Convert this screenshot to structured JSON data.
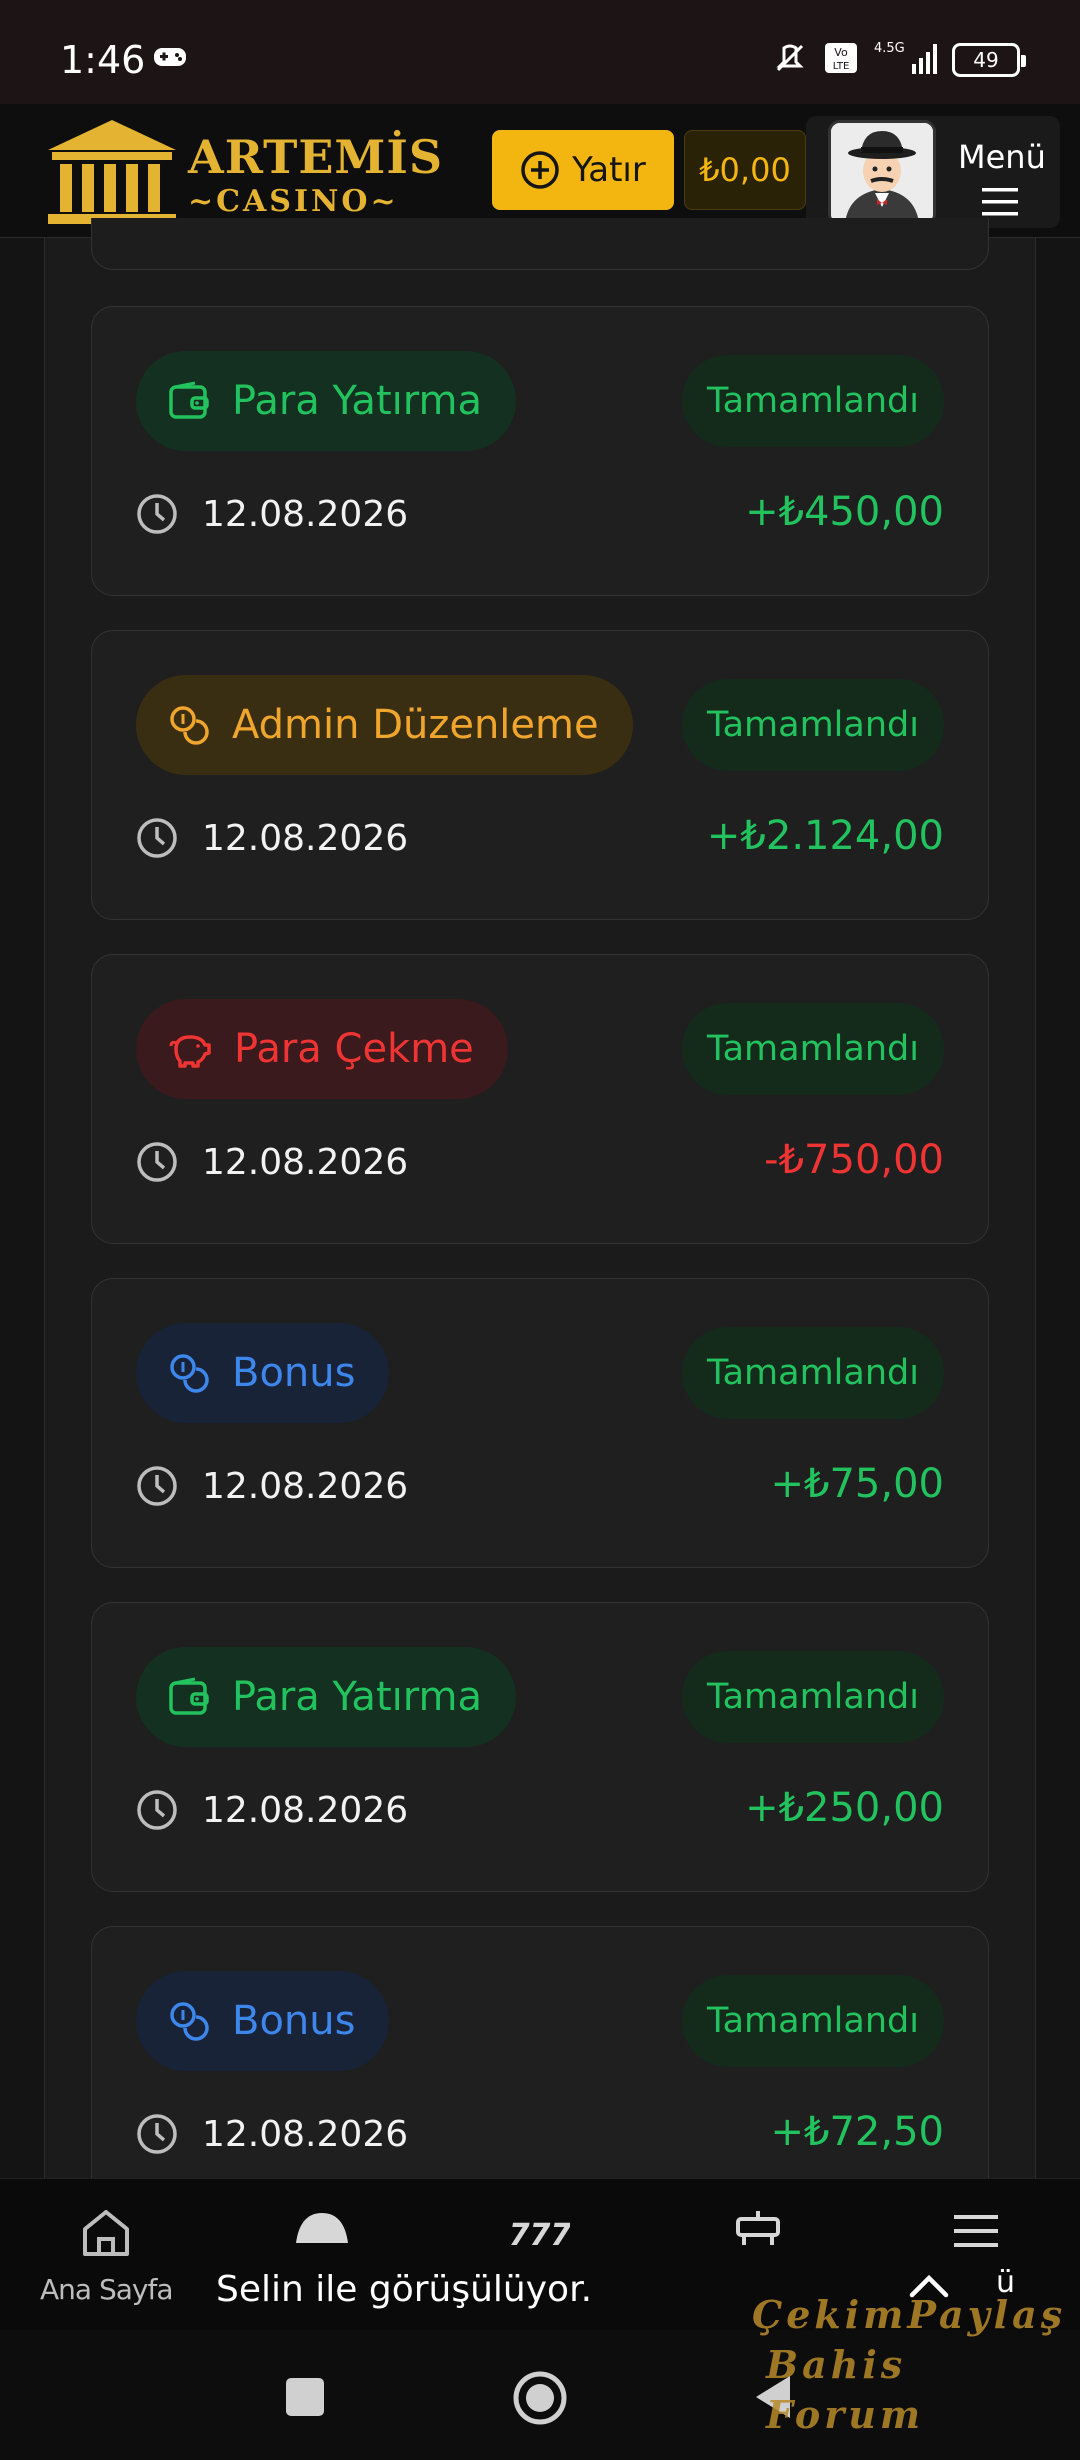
{
  "status_bar": {
    "time": "1:46",
    "battery": "49",
    "network": "4.5G"
  },
  "header": {
    "logo_name": "ARTEMİS",
    "logo_sub": "CASINO",
    "deposit_label": "Yatır",
    "balance": "₺0,00",
    "menu_label": "Menü"
  },
  "transactions": [
    {
      "type": "Para Yatırma",
      "status": "Tamamlandı",
      "date": "12.08.2026",
      "amount": "+₺450,00",
      "kind": "deposit"
    },
    {
      "type": "Admin Düzenleme",
      "status": "Tamamlandı",
      "date": "12.08.2026",
      "amount": "+₺2.124,00",
      "kind": "admin"
    },
    {
      "type": "Para Çekme",
      "status": "Tamamlandı",
      "date": "12.08.2026",
      "amount": "-₺750,00",
      "kind": "withdraw"
    },
    {
      "type": "Bonus",
      "status": "Tamamlandı",
      "date": "12.08.2026",
      "amount": "+₺75,00",
      "kind": "bonus"
    },
    {
      "type": "Para Yatırma",
      "status": "Tamamlandı",
      "date": "12.08.2026",
      "amount": "+₺250,00",
      "kind": "deposit"
    },
    {
      "type": "Bonus",
      "status": "Tamamlandı",
      "date": "12.08.2026",
      "amount": "+₺72,50",
      "kind": "bonus"
    }
  ],
  "bottom_nav": {
    "home_label": "Ana Sayfa",
    "toast": "Selin ile görüşülüyor.",
    "trailing_char": "ü"
  },
  "watermark": {
    "line1": "ÇekimPaylaş",
    "line2": "Bahis Forum"
  }
}
